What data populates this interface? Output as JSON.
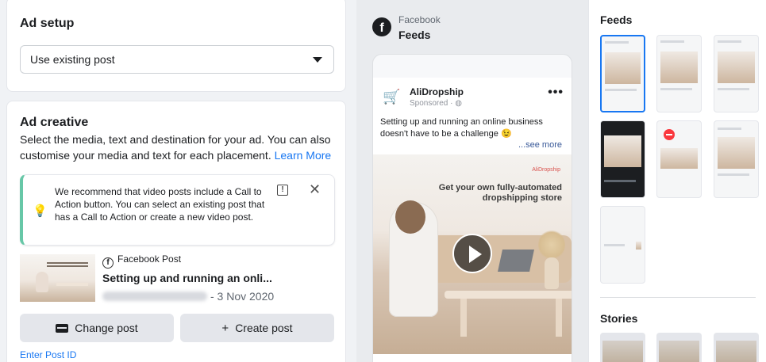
{
  "ad_setup": {
    "title": "Ad setup",
    "dropdown_value": "Use existing post"
  },
  "ad_creative": {
    "title": "Ad creative",
    "description": "Select the media, text and destination for your ad. You can also customise your media and text for each placement.",
    "learn_more": "Learn More",
    "notice": {
      "text": "We recommend that video posts include a Call to Action button. You can select an existing post that has a Call to Action or create a new video post."
    },
    "post": {
      "source": "Facebook Post",
      "title": "Setting up and running an onli...",
      "date": "- 3 Nov 2020"
    },
    "change_post": "Change post",
    "create_post": "Create post",
    "enter_post_id": "Enter Post ID"
  },
  "preview": {
    "platform": "Facebook",
    "placement": "Feeds",
    "page_name": "AliDropship",
    "sponsored": "Sponsored · ",
    "post_text": "Setting up and running an online business doesn't have to be a challenge 😉",
    "see_more": "...see more",
    "media_brand": "AliDropship",
    "media_headline": "Get your own fully-automated dropshipping store"
  },
  "placements": {
    "feeds_title": "Feeds",
    "stories_title": "Stories"
  },
  "colors": {
    "accent": "#1877f2",
    "notice_border": "#67c7a7"
  }
}
